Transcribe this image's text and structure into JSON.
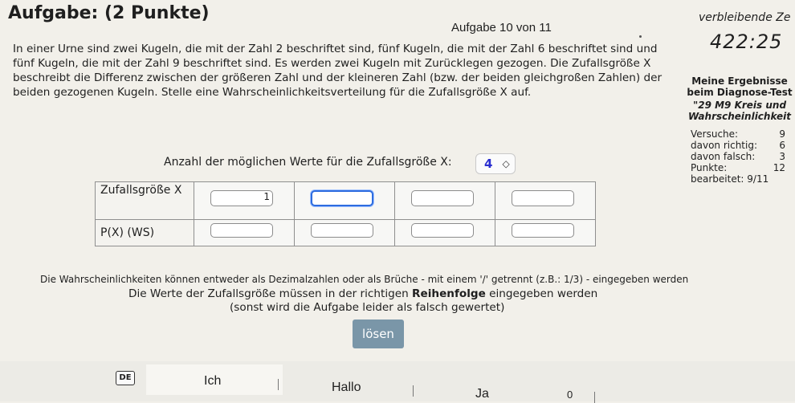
{
  "header": {
    "title": "Aufgabe: (2 Punkte)",
    "counter": "Aufgabe 10 von 11",
    "remaining_label": "verbleibende Ze",
    "timer": "422:25"
  },
  "task": {
    "text": "In einer Urne sind zwei Kugeln, die mit der Zahl 2 beschriftet sind, fünf Kugeln, die mit der Zahl 6 beschriftet sind und fünf Kugeln, die mit der Zahl 9 beschriftet sind. Es werden zwei Kugeln mit Zurücklegen gezogen. Die Zufallsgröße X beschreibt die Differenz zwischen der größeren Zahl und der kleineren Zahl (bzw. der beiden gleichgroßen Zahlen) der beiden gezogenen Kugeln. Stelle eine Wahrscheinlichkeitsverteilung für die Zufallsgröße X auf."
  },
  "results": {
    "heading": "Meine Ergebnisse beim Diagnose-Test",
    "test_name": "\"29 M9 Kreis und Wahrscheinlichkeit",
    "rows": [
      {
        "label": "Versuche:",
        "value": "9"
      },
      {
        "label": "davon richtig:",
        "value": "6"
      },
      {
        "label": "davon falsch:",
        "value": "3"
      },
      {
        "label": "Punkte:",
        "value": "12"
      }
    ],
    "processed": "bearbeitet: 9/11"
  },
  "count": {
    "label": "Anzahl der möglichen Werte für die Zufallsgröße X:",
    "value": "4",
    "arrows": "◇"
  },
  "table": {
    "row1_label": "Zufallsgröße X",
    "row2_label": "P(X) (WS)",
    "x_values": [
      "1",
      "",
      "",
      "",
      ""
    ],
    "p_values": [
      "",
      "",
      "",
      "",
      ""
    ]
  },
  "notes": {
    "line1": "Die Wahrscheinlichkeiten können entweder als Dezimalzahlen oder als Brüche - mit einem '/' getrennt (z.B.: 1/3) - eingegeben werden",
    "line2_pre": "Die Werte der Zufallsgröße müssen in der richtigen ",
    "line2_bold": "Reihenfolge",
    "line2_post": " eingegeben werden",
    "line3": "(sonst wird die Aufgabe leider als falsch gewertet)"
  },
  "solve_label": "lösen",
  "keyboard": {
    "lang": "DE",
    "suggestions": [
      "Ich",
      "Hallo",
      "Ja"
    ],
    "emoji_hint": "0"
  }
}
